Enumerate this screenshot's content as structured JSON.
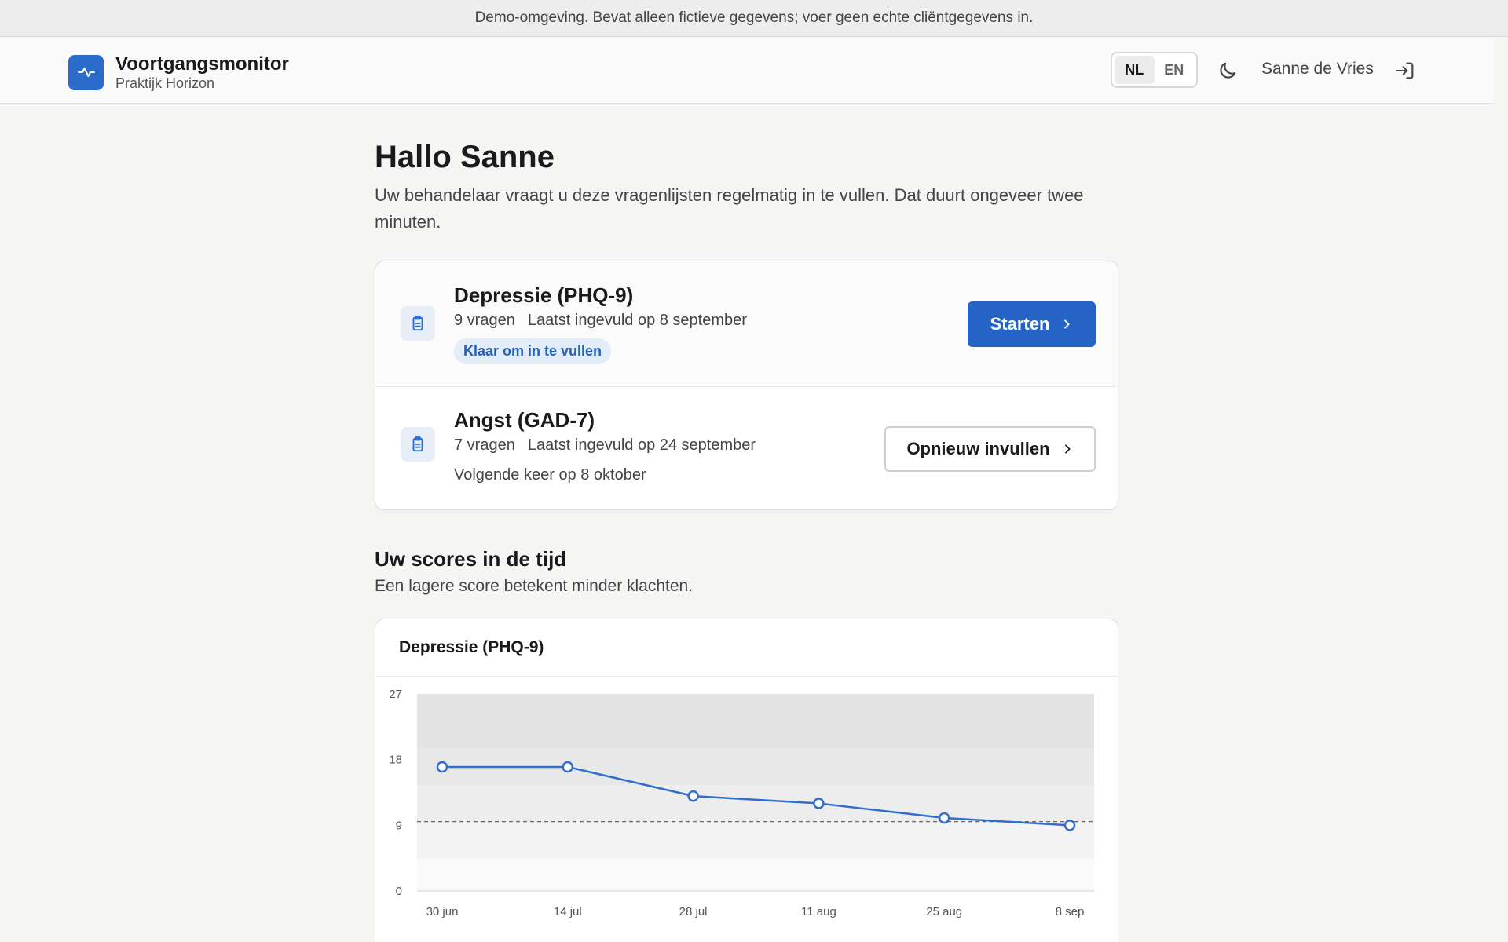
{
  "banner": {
    "text": "Demo-omgeving. Bevat alleen fictieve gegevens; voer geen echte cliëntgegevens in."
  },
  "header": {
    "app_title": "Voortgangsmonitor",
    "practice": "Praktijk Horizon",
    "languages": [
      "NL",
      "EN"
    ],
    "active_language": "NL",
    "user_name": "Sanne de Vries",
    "icons": {
      "logo": "activity-pulse-icon",
      "theme": "moon-icon",
      "logout": "sign-in-arrow-icon"
    }
  },
  "main": {
    "greeting": "Hallo Sanne",
    "intro": "Uw behandelaar vraagt u deze vragenlijsten regelmatig in te vullen. Dat duurt ongeveer twee minuten.",
    "questionnaires": [
      {
        "title": "Depressie (PHQ-9)",
        "questions": "9 vragen",
        "last_filled": "Laatst ingevuld op 8 september",
        "badge": "Klaar om in te vullen",
        "button": "Starten",
        "icon": "clipboard-icon"
      },
      {
        "title": "Angst (GAD-7)",
        "questions": "7 vragen",
        "last_filled": "Laatst ingevuld op 24 september",
        "next": "Volgende keer op 8 oktober",
        "button": "Opnieuw invullen",
        "icon": "clipboard-icon"
      }
    ],
    "scores_title": "Uw scores in de tijd",
    "scores_sub": "Een lagere score betekent minder klachten."
  },
  "colors": {
    "accent": "#2564c4",
    "badge_bg": "#e3edf9",
    "line": "#2f6fcb"
  },
  "chart_data": {
    "type": "line",
    "title": "Depressie (PHQ-9)",
    "categories": [
      "30 jun",
      "14 jul",
      "28 jul",
      "11 aug",
      "25 aug",
      "8 sep"
    ],
    "series": [
      {
        "values": [
          17,
          17,
          13,
          12,
          10,
          9
        ]
      }
    ],
    "yticks": [
      0,
      9,
      18,
      27
    ],
    "ylim": [
      0,
      27
    ],
    "threshold": 9.5,
    "bands": [
      {
        "from": 0,
        "to": 4.5,
        "fill": "#fafafa"
      },
      {
        "from": 4.5,
        "to": 9.5,
        "fill": "#f3f3f3"
      },
      {
        "from": 9.5,
        "to": 14.5,
        "fill": "#ededed"
      },
      {
        "from": 14.5,
        "to": 19.5,
        "fill": "#e8e8e8"
      },
      {
        "from": 19.5,
        "to": 27,
        "fill": "#e3e3e3"
      }
    ]
  }
}
